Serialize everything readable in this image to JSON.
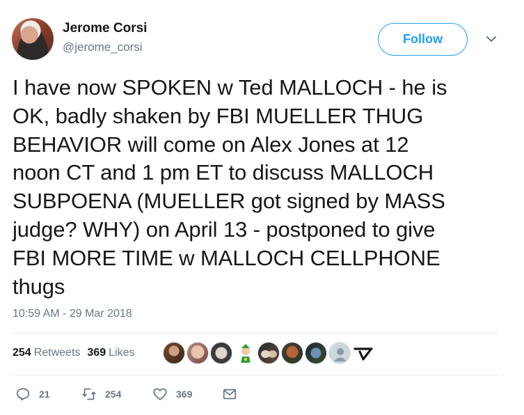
{
  "author": {
    "name": "Jerome Corsi",
    "handle": "@jerome_corsi"
  },
  "follow_button": {
    "label": "Follow"
  },
  "tweet": {
    "text": "I have now SPOKEN w Ted MALLOCH - he is\nOK, badly shaken by FBI MUELLER THUG\nBEHAVIOR will come on Alex Jones at 12\nnoon CT  and 1 pm ET to discuss MALLOCH\nSUBPOENA (MUELLER got signed by MASS\njudge? WHY) on April 13 - postponed to give\nFBI MORE TIME w MALLOCH CELLPHONE\nthugs",
    "timestamp": "10:59 AM - 29 Mar 2018"
  },
  "stats": {
    "retweets_count": "254",
    "retweets_label": "Retweets",
    "likes_count": "369",
    "likes_label": "Likes"
  },
  "liked_by_avatars": [
    {
      "icon": "avatar-photo-1"
    },
    {
      "icon": "avatar-photo-2"
    },
    {
      "icon": "avatar-photo-3"
    },
    {
      "icon": "avatar-cartoon-leprechaun"
    },
    {
      "icon": "avatar-photo-5"
    },
    {
      "icon": "avatar-photo-6"
    },
    {
      "icon": "avatar-photo-7"
    },
    {
      "icon": "avatar-default-egg"
    },
    {
      "icon": "avatar-logo-glyph"
    }
  ],
  "actions": {
    "reply_count": "21",
    "retweet_count": "254",
    "like_count": "369"
  },
  "colors": {
    "accent": "#1da1f2",
    "secondary_text": "#657786",
    "primary_text": "#14171a",
    "divider": "#e6ecf0"
  }
}
